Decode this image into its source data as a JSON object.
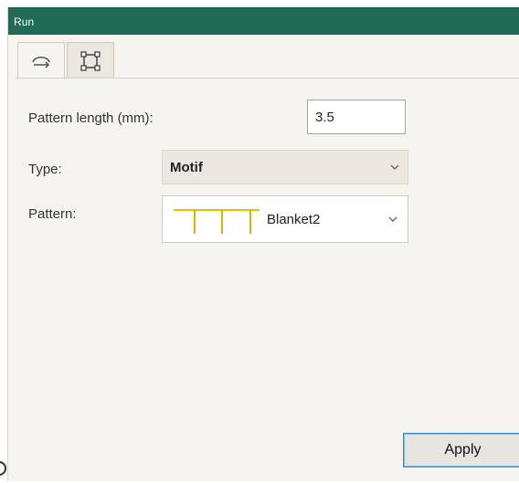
{
  "window": {
    "title": "Run"
  },
  "tabs": [
    {
      "icon": "run-stitch-icon",
      "selected": true
    },
    {
      "icon": "frame-corners-icon",
      "selected": false
    }
  ],
  "form": {
    "pattern_length": {
      "label": "Pattern length (mm):",
      "value": "3.5"
    },
    "type": {
      "label": "Type:",
      "selected": "Motif"
    },
    "pattern": {
      "label": "Pattern:",
      "selected": "Blanket2",
      "preview_icon": "blanket-stitch-preview-icon"
    }
  },
  "actions": {
    "apply_label": "Apply"
  },
  "colors": {
    "title_bar": "#1f6b56",
    "panel_background": "#f6f4ef",
    "stitch_preview": "#e6c400"
  }
}
